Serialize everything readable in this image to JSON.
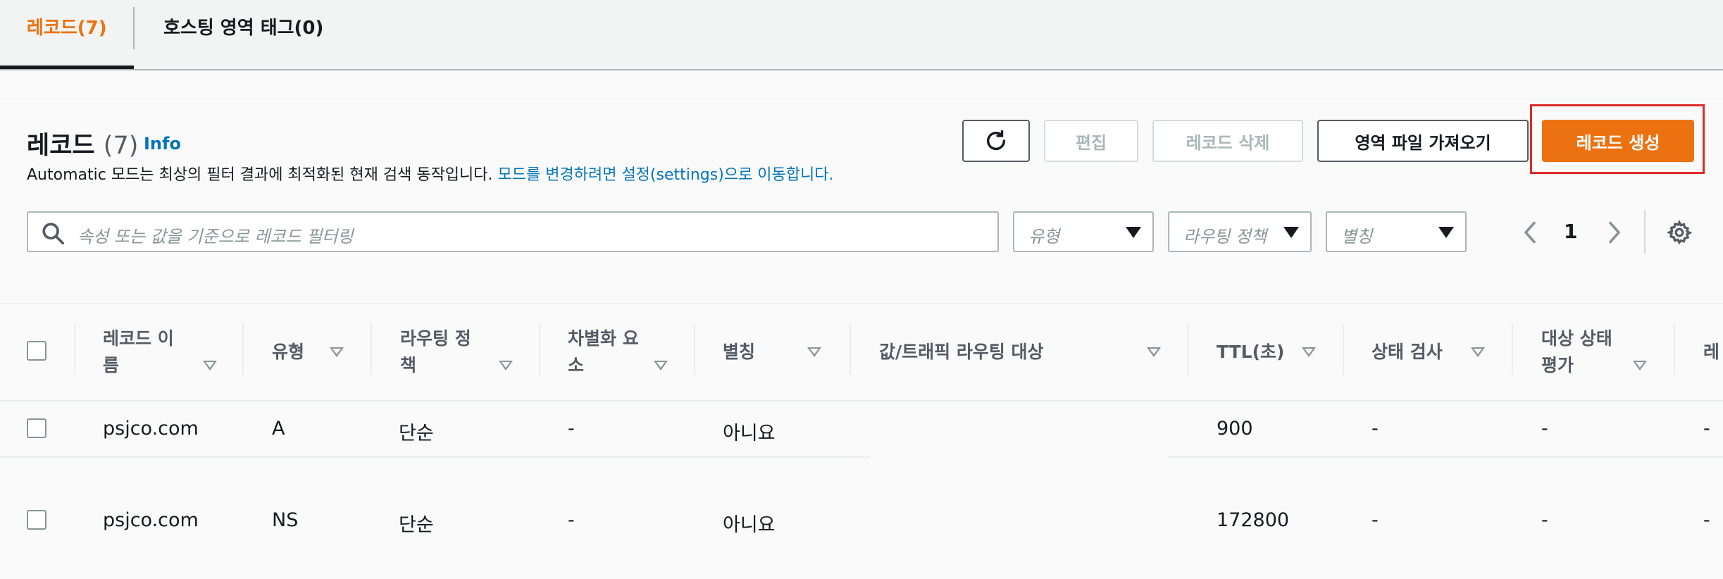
{
  "tabs": [
    {
      "label": "레코드(7)",
      "active": true
    },
    {
      "label": "호스팅 영역 태그(0)",
      "active": false
    }
  ],
  "header": {
    "title": "레코드",
    "count": "(7)",
    "info": "Info",
    "desc_text": "Automatic 모드는 최상의 필터 결과에 최적화된 현재 검색 동작입니다.",
    "desc_link": "모드를 변경하려면 설정(settings)으로 이동합니다."
  },
  "toolbar": {
    "refresh": "refresh-icon",
    "edit": "편집",
    "delete": "레코드 삭제",
    "import": "영역 파일 가져오기",
    "create": "레코드 생성"
  },
  "filter": {
    "search_placeholder": "속성 또는 값을 기준으로 레코드 필터링",
    "type_placeholder": "유형",
    "routing_placeholder": "라우팅 정책",
    "alias_placeholder": "별칭"
  },
  "pagination": {
    "current": "1"
  },
  "columns": [
    {
      "line1": "레코드 이",
      "line2": "름"
    },
    {
      "line1": "유형",
      "line2": ""
    },
    {
      "line1": "라우팅 정",
      "line2": "책"
    },
    {
      "line1": "차별화 요",
      "line2": "소"
    },
    {
      "line1": "별칭",
      "line2": ""
    },
    {
      "line1": "값/트래픽 라우팅 대상",
      "line2": ""
    },
    {
      "line1": "TTL(초)",
      "line2": ""
    },
    {
      "line1": "상태 검사",
      "line2": ""
    },
    {
      "line1": "대상 상태",
      "line2": "평가"
    },
    {
      "line1": "레",
      "line2": ""
    }
  ],
  "rows": [
    {
      "name": "psjco.com",
      "type": "A",
      "routing": "단순",
      "diff": "-",
      "alias": "아니요",
      "value": "",
      "ttl": "900",
      "health": "-",
      "eval": "-",
      "extra": "-"
    },
    {
      "name": "psjco.com",
      "type": "NS",
      "routing": "단순",
      "diff": "-",
      "alias": "아니요",
      "value": "",
      "ttl": "172800",
      "health": "-",
      "eval": "-",
      "extra": "-"
    }
  ],
  "colors": {
    "accent": "#ec7211",
    "link": "#0073bb",
    "highlight": "#e02b27"
  }
}
